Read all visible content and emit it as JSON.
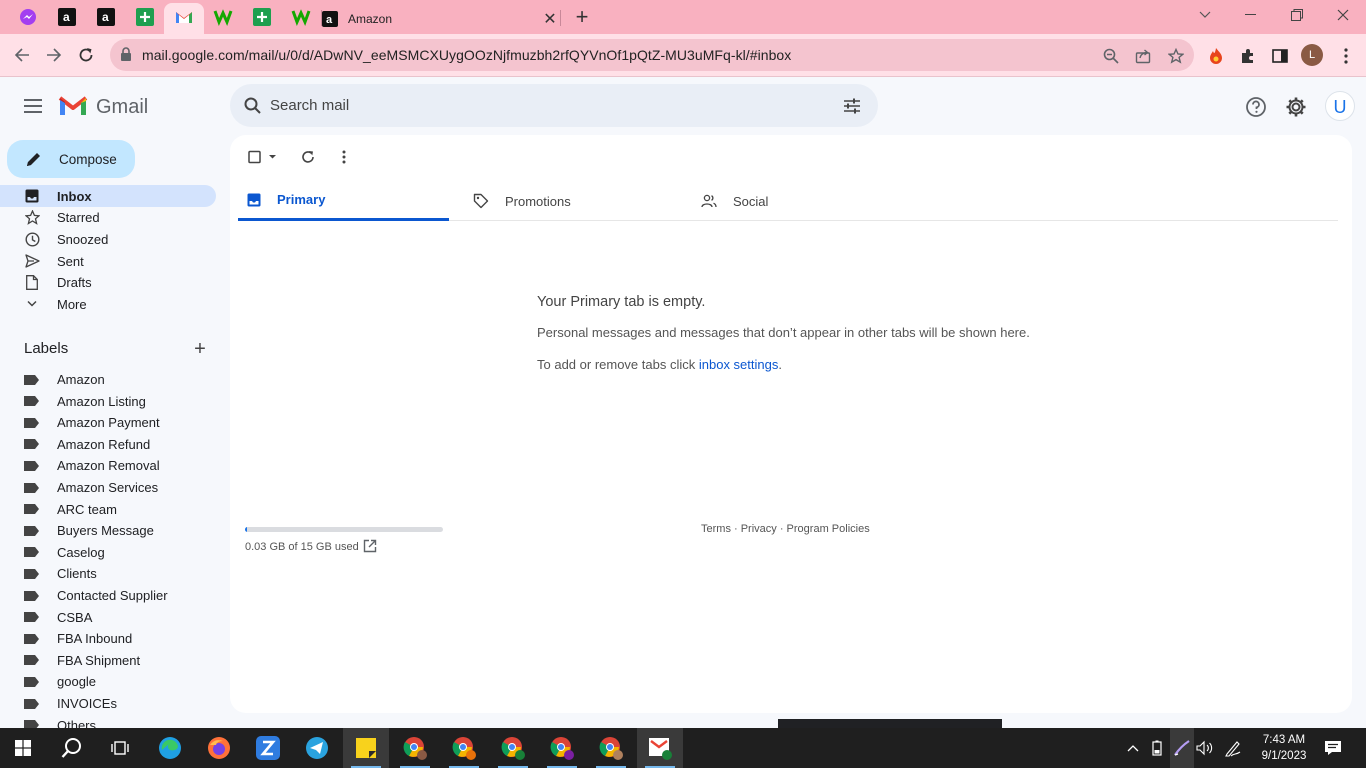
{
  "browser": {
    "active_tab_icon": "gmail-icon",
    "amazon_tab_title": "Amazon",
    "url": "mail.google.com/mail/u/0/d/ADwNV_eeMSMCXUygOOzNjfmuzbh2rfQYVnOf1pQtZ-MU3uMFq-kl/#inbox",
    "profile_initial": "L",
    "tab_icons": [
      "messenger-icon",
      "amazon-icon",
      "amazon-icon",
      "sheets-icon",
      "gmail-icon",
      "upwork-icon",
      "sheets-icon",
      "upwork-icon",
      "amazon-icon"
    ]
  },
  "gmail": {
    "brand": "Gmail",
    "search_placeholder": "Search mail",
    "account_initial": "U",
    "compose_label": "Compose",
    "nav": [
      {
        "label": "Inbox",
        "icon": "inbox-icon",
        "active": true
      },
      {
        "label": "Starred",
        "icon": "star-icon"
      },
      {
        "label": "Snoozed",
        "icon": "clock-icon"
      },
      {
        "label": "Sent",
        "icon": "send-icon"
      },
      {
        "label": "Drafts",
        "icon": "draft-icon"
      },
      {
        "label": "More",
        "icon": "chevron-down-icon"
      }
    ],
    "labels_heading": "Labels",
    "labels": [
      "Amazon",
      "Amazon Listing",
      "Amazon Payment",
      "Amazon Refund",
      "Amazon Removal",
      "Amazon Services",
      "ARC team",
      "Buyers Message",
      "Caselog",
      "Clients",
      "Contacted Supplier",
      "CSBA",
      "FBA Inbound",
      "FBA Shipment",
      "google",
      "INVOICEs",
      "Others"
    ],
    "tabs": [
      {
        "label": "Primary",
        "icon": "inbox-icon",
        "active": true
      },
      {
        "label": "Promotions",
        "icon": "tag-icon"
      },
      {
        "label": "Social",
        "icon": "people-icon"
      }
    ],
    "empty_title": "Your Primary tab is empty.",
    "empty_sub": "Personal messages and messages that don’t appear in other tabs will be shown here.",
    "empty_add_prefix": "To add or remove tabs click ",
    "empty_add_link": "inbox settings",
    "empty_add_suffix": ".",
    "storage_text": "0.03 GB of 15 GB used",
    "storage_fraction": 0.002,
    "footer": "Terms · Privacy · Program Policies"
  },
  "taskbar": {
    "time": "7:43 AM",
    "date": "9/1/2023"
  },
  "colors": {
    "tabstrip": "#f9b1c0",
    "toolbar": "#ffe0e7",
    "accent": "#0b57d0",
    "compose": "#c2e7ff"
  }
}
